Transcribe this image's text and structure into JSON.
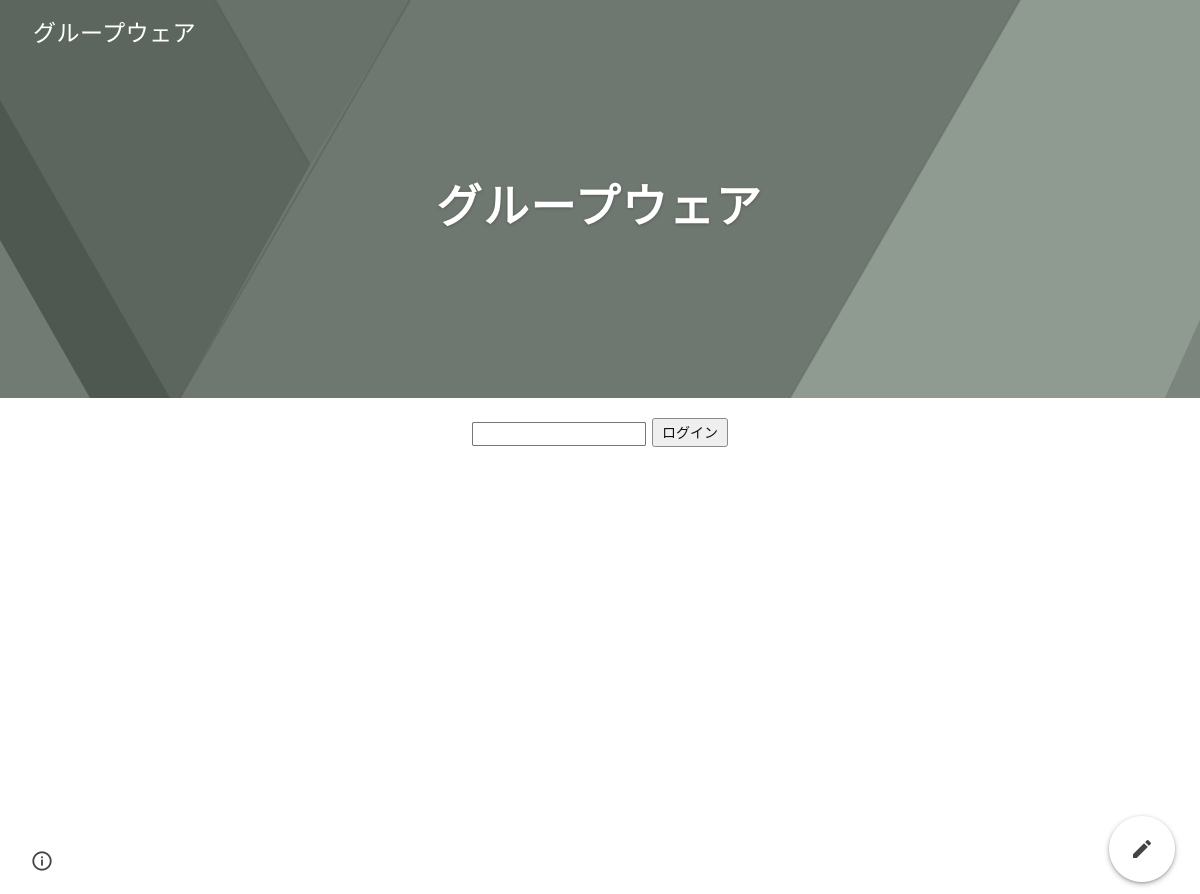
{
  "header": {
    "site_name": "グループウェア",
    "banner_title": "グループウェア"
  },
  "login": {
    "input_value": "",
    "input_placeholder": "",
    "button_label": "ログイン"
  },
  "footer": {
    "info_icon": "info-icon",
    "edit_icon": "pencil-icon"
  },
  "colors": {
    "banner_base": "#6c756d",
    "banner_dark": "#555e57",
    "banner_light": "#8e9990",
    "text_on_banner": "#ffffff"
  }
}
